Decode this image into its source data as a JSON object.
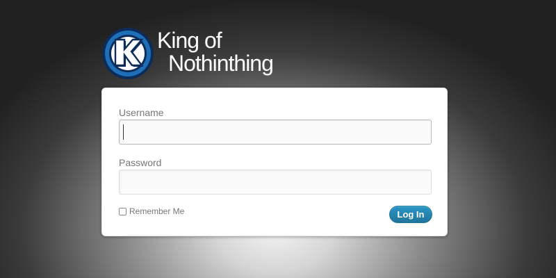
{
  "logo": {
    "icon": "king-k-badge-icon",
    "letter": "K",
    "line1": "King of",
    "line2": "Nothinthing"
  },
  "form": {
    "username_label": "Username",
    "username_value": "",
    "password_label": "Password",
    "password_value": "",
    "remember_label": "Remember Me",
    "remember_checked": false,
    "submit_label": "Log In"
  },
  "colors": {
    "accent": "#21759b",
    "badge_blue": "#1d6fb8",
    "badge_dark": "#0c2d5a",
    "background_dark": "#222222",
    "card": "#ffffff",
    "label_text": "#777777"
  }
}
